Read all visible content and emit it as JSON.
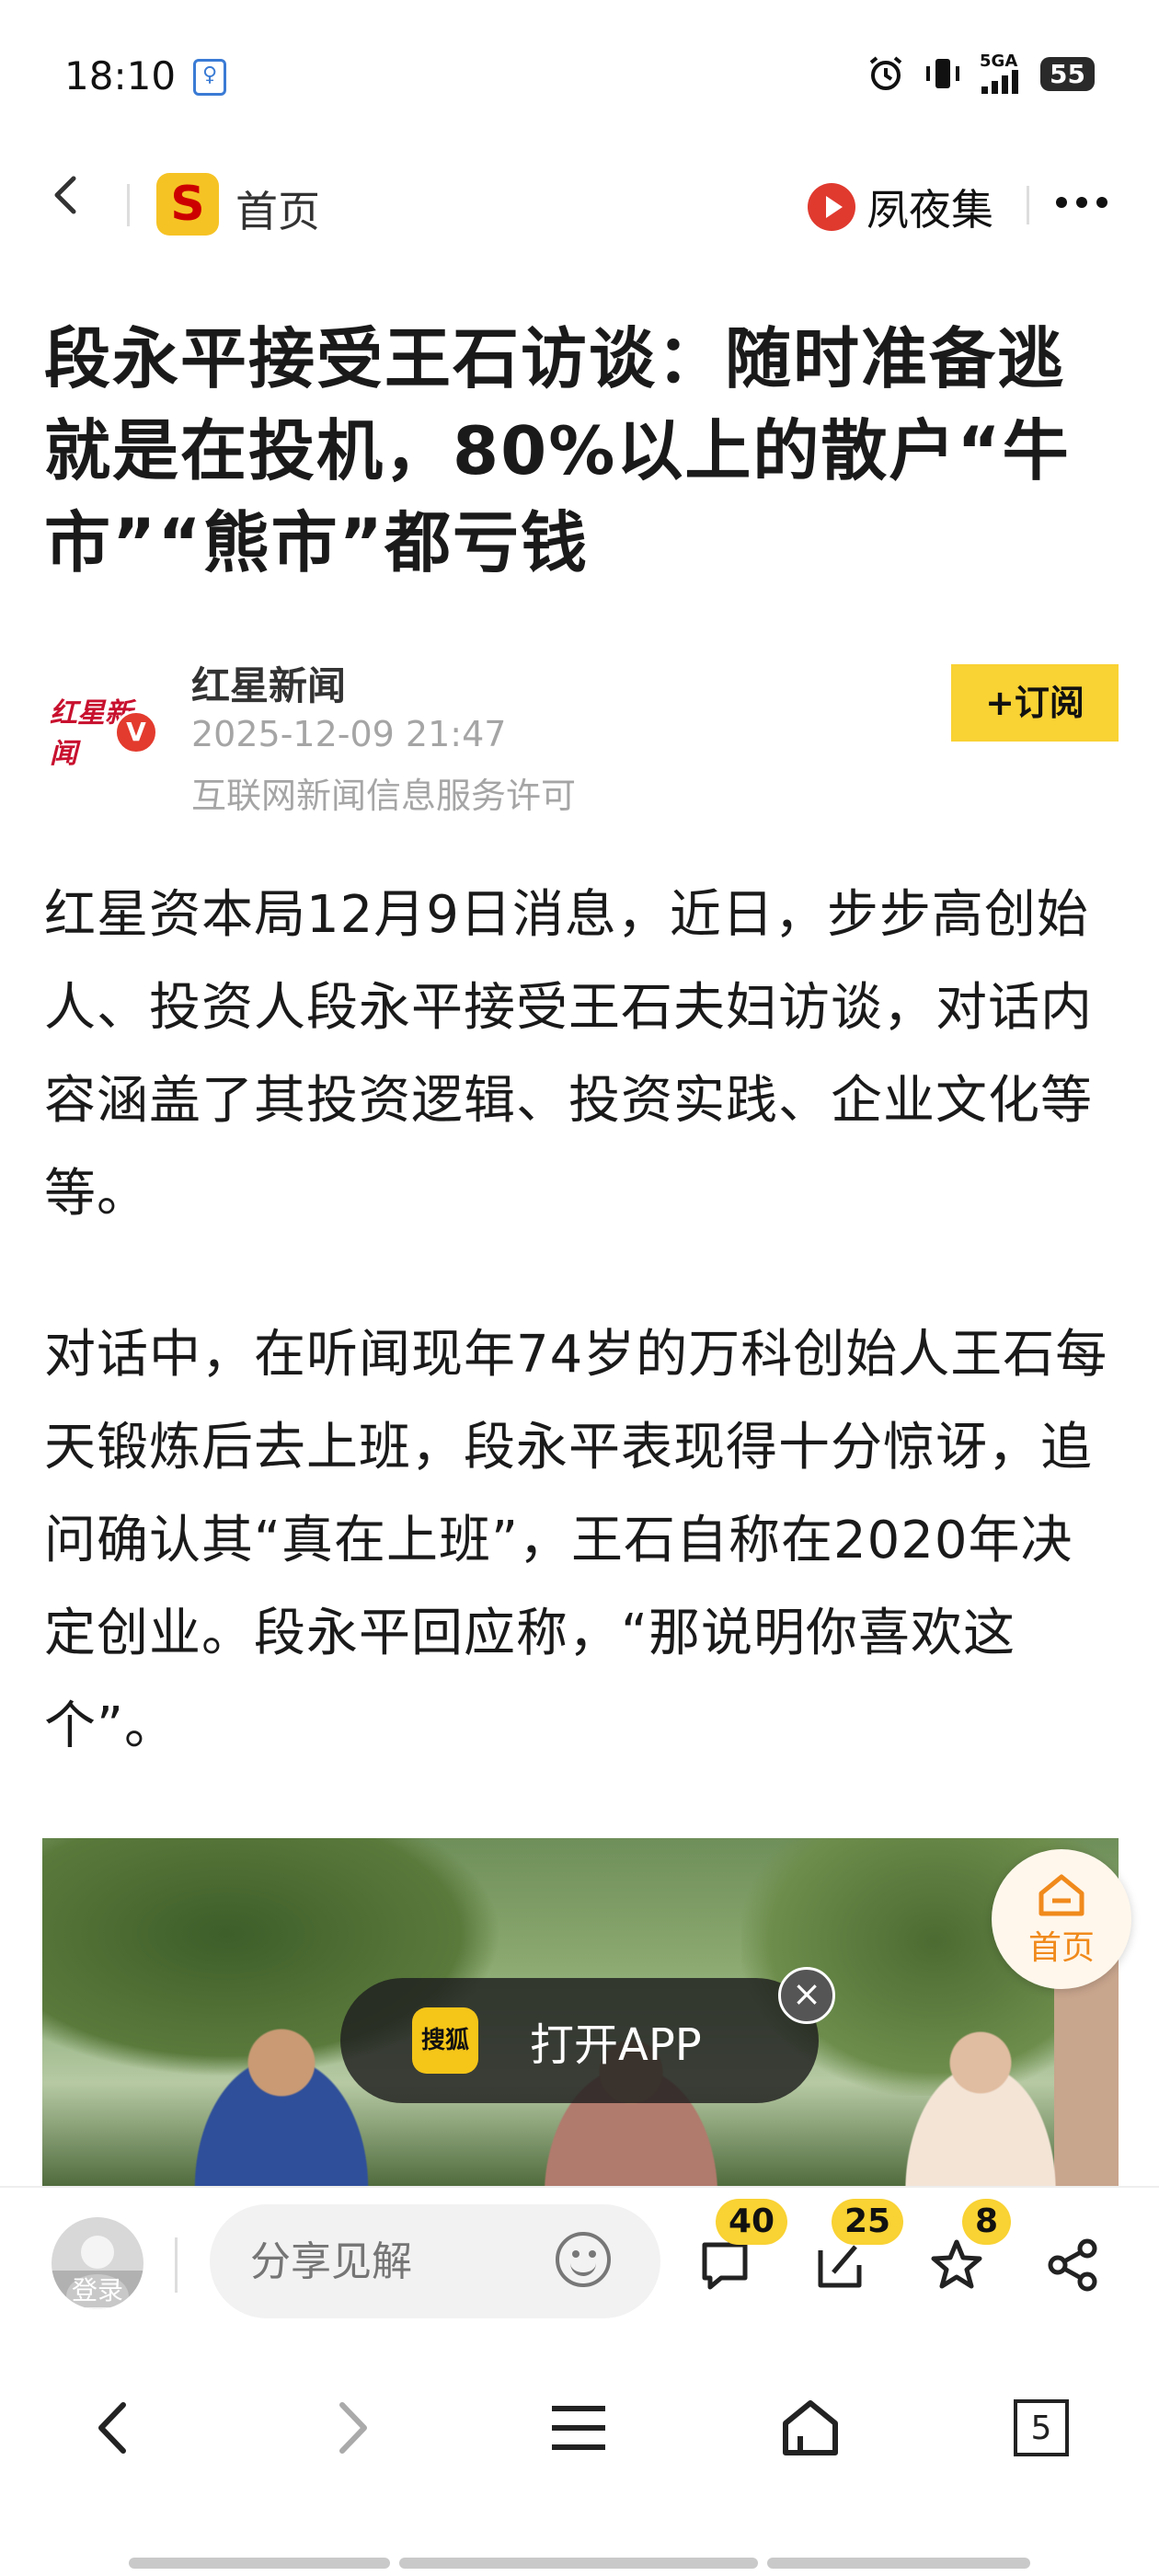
{
  "status_bar": {
    "time": "18:10",
    "vpn_glyph": "♀",
    "network": "5GA",
    "battery": "55"
  },
  "header": {
    "home_label": "首页",
    "channel_label": "夙夜集"
  },
  "article": {
    "title": "段永平接受王石访谈：随时准备逃就是在投机，80%以上的散户“牛市”“熊市”都亏钱",
    "author": {
      "name": "红星新闻",
      "avatar_text": "红星新闻",
      "verified_badge": "V",
      "time": "2025-12-09 21:47",
      "license": "互联网新闻信息服务许可"
    },
    "subscribe_label": "+订阅",
    "paragraphs": [
      "红星资本局12月9日消息，近日，步步高创始人、投资人段永平接受王石夫妇访谈，对话内容涵盖了其投资逻辑、投资实践、企业文化等等。",
      "对话中，在听闻现年74岁的万科创始人王石每天锻炼后去上班，段永平表现得十分惊讶，追问确认其“真在上班”，王石自称在2020年决定创业。段永平回应称，“那说明你喜欢这个”。"
    ]
  },
  "open_app": {
    "label": "打开APP",
    "icon_text": "搜狐"
  },
  "float_home": {
    "label": "首页"
  },
  "comment_bar": {
    "login_label": "登录",
    "placeholder": "分享见解",
    "comments_count": "40",
    "reposts_count": "25",
    "favorites_count": "8"
  },
  "nav_bar": {
    "tabs_count": "5"
  }
}
